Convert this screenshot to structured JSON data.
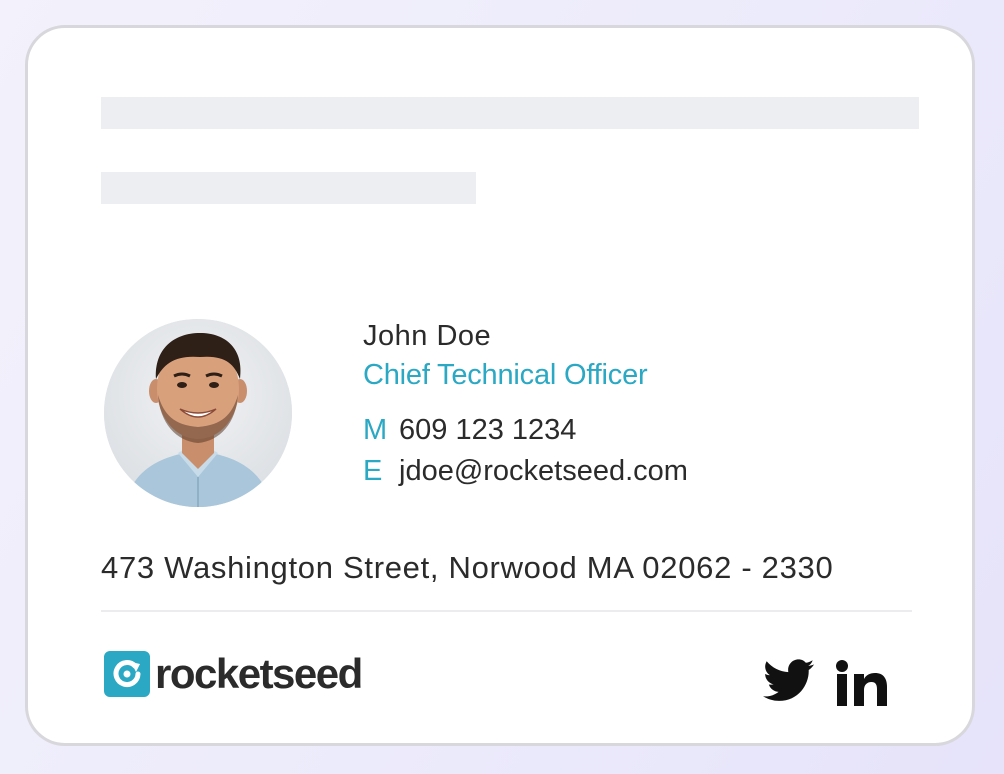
{
  "signature": {
    "name": "John Doe",
    "job_title": "Chief Technical Officer",
    "mobile": {
      "label": "M",
      "value": "609 123 1234"
    },
    "email": {
      "label": "E",
      "value": "jdoe@rocketseed.com"
    },
    "address": "473 Washington Street, Norwood MA 02062 - 2330",
    "avatar_icon": "profile-photo",
    "accent_color": "#2aa8c4"
  },
  "branding": {
    "logo_text": "rocketseed",
    "logo_icon": "rocketseed-logo-icon",
    "brand_color": "#2aa8c4"
  },
  "social": {
    "twitter_icon": "twitter-bird-icon",
    "linkedin_icon": "linkedin-in-icon"
  }
}
